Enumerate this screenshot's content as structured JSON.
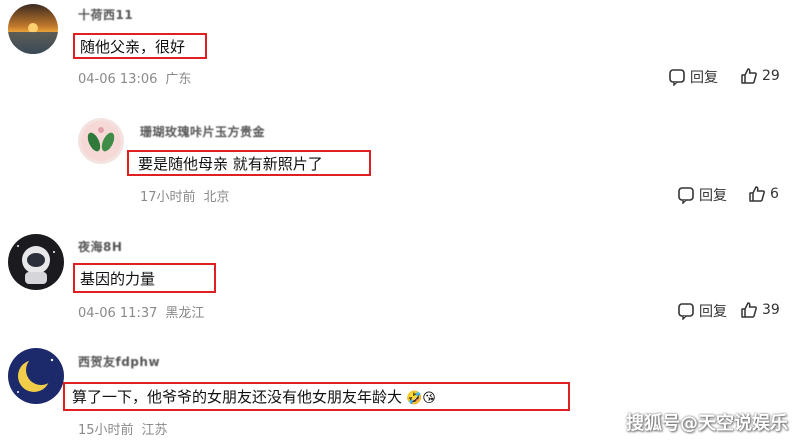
{
  "comments": [
    {
      "username": "十荷西11",
      "text": "随他父亲，很好",
      "time": "04-06 13:06",
      "location": "广东",
      "reply_label": "回复",
      "likes": "29"
    },
    {
      "username": "珊瑚玫瑰咔片玉方贵金",
      "text": "要是随他母亲 就有新照片了",
      "time": "17小时前",
      "location": "北京",
      "reply_label": "回复",
      "likes": "6"
    },
    {
      "username": "夜海8H",
      "text": "基因的力量",
      "time": "04-06 11:37",
      "location": "黑龙江",
      "reply_label": "回复",
      "likes": "39"
    },
    {
      "username": "西贺友fdphw",
      "text": "算了一下，他爷爷的女朋友还没有他女朋友年龄大",
      "emoji": "🤣😘",
      "time": "15小时前",
      "location": "江苏"
    }
  ],
  "watermark": "搜狐号@天空说娱乐",
  "colors": {
    "highlight_border": "#e02020",
    "meta_gray": "#8a8a8a"
  }
}
